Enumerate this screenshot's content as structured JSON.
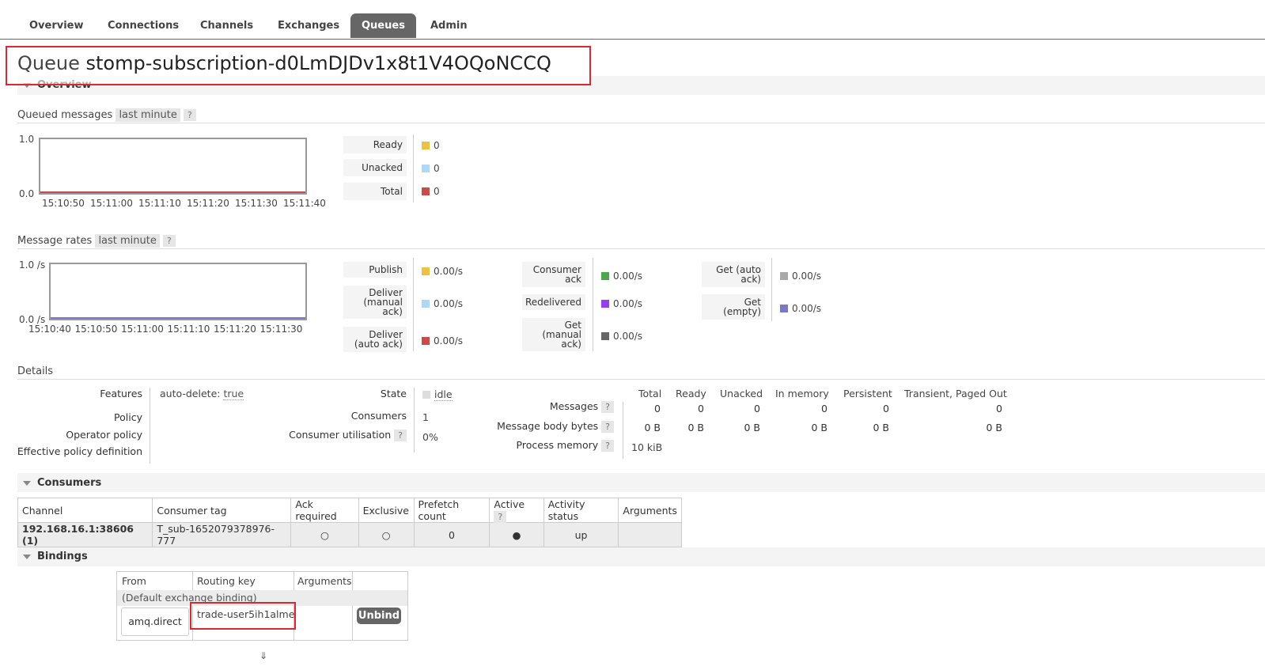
{
  "tabs": [
    {
      "label": "Overview"
    },
    {
      "label": "Connections"
    },
    {
      "label": "Channels"
    },
    {
      "label": "Exchanges"
    },
    {
      "label": "Queues"
    },
    {
      "label": "Admin"
    }
  ],
  "title": {
    "prefix": "Queue",
    "name": "stomp-subscription-d0LmDJDv1x8t1V4OQoNCCQ"
  },
  "overview_section": "Overview",
  "queued_messages": {
    "heading": "Queued messages",
    "range": "last minute",
    "help": "?",
    "y_top": "1.0",
    "y_bottom": "0.0",
    "x_ticks": [
      "15:10:50",
      "15:11:00",
      "15:11:10",
      "15:11:20",
      "15:11:30",
      "15:11:40"
    ],
    "legend": [
      {
        "label": "Ready",
        "value": "0",
        "color": "#edc240"
      },
      {
        "label": "Unacked",
        "value": "0",
        "color": "#afd8f8"
      },
      {
        "label": "Total",
        "value": "0",
        "color": "#cb4b4b"
      }
    ]
  },
  "message_rates": {
    "heading": "Message rates",
    "range": "last minute",
    "help": "?",
    "y_top": "1.0 /s",
    "y_bottom": "0.0 /s",
    "x_ticks": [
      "15:10:40",
      "15:10:50",
      "15:11:00",
      "15:11:10",
      "15:11:20",
      "15:11:30"
    ],
    "col1": [
      {
        "label": "Publish",
        "value": "0.00/s",
        "color": "#edc240"
      },
      {
        "label": "Deliver (manual ack)",
        "value": "0.00/s",
        "color": "#afd8f8"
      },
      {
        "label": "Deliver (auto ack)",
        "value": "0.00/s",
        "color": "#cb4b4b"
      }
    ],
    "col2": [
      {
        "label": "Consumer ack",
        "value": "0.00/s",
        "color": "#4da74d"
      },
      {
        "label": "Redelivered",
        "value": "0.00/s",
        "color": "#9440ed"
      },
      {
        "label": "Get (manual ack)",
        "value": "0.00/s",
        "color": "#666666"
      }
    ],
    "col3": [
      {
        "label": "Get (auto ack)",
        "value": "0.00/s",
        "color": "#aaaaaa"
      },
      {
        "label": "Get (empty)",
        "value": "0.00/s",
        "color": "#7c79c3"
      }
    ]
  },
  "details": {
    "heading": "Details",
    "features_label": "Features",
    "features_key": "auto-delete:",
    "features_value": "true",
    "policy_label": "Policy",
    "operator_policy_label": "Operator policy",
    "effective_policy_label": "Effective policy definition",
    "state_label": "State",
    "state_value": "idle",
    "consumers_label": "Consumers",
    "consumers_value": "1",
    "utilisation_label": "Consumer utilisation",
    "utilisation_value": "0%",
    "help": "?",
    "stats_headers": [
      "Total",
      "Ready",
      "Unacked",
      "In memory",
      "Persistent",
      "Transient, Paged Out"
    ],
    "messages_label": "Messages",
    "messages_values": [
      "0",
      "0",
      "0",
      "0",
      "0",
      "0"
    ],
    "body_bytes_label": "Message body bytes",
    "body_bytes_values": [
      "0 B",
      "0 B",
      "0 B",
      "0 B",
      "0 B",
      "0 B"
    ],
    "process_memory_label": "Process memory",
    "process_memory_value": "10 kiB"
  },
  "consumers": {
    "heading": "Consumers",
    "headers": [
      "Channel",
      "Consumer tag",
      "Ack required",
      "Exclusive",
      "Prefetch count",
      "Active",
      "Activity status",
      "Arguments"
    ],
    "active_help": "?",
    "rows": [
      {
        "channel": "192.168.16.1:38606 (1)",
        "tag": "T_sub-1652079378976-777",
        "ack": "○",
        "exclusive": "○",
        "prefetch": "0",
        "active": "●",
        "status": "up",
        "arguments": ""
      }
    ]
  },
  "bindings": {
    "heading": "Bindings",
    "headers": [
      "From",
      "Routing key",
      "Arguments"
    ],
    "default_row": "(Default exchange binding)",
    "rows": [
      {
        "from": "amq.direct",
        "routing_key": "trade-user5ih1alme",
        "arguments": "",
        "action": "Unbind"
      }
    ],
    "footer_mark": "⇓"
  }
}
